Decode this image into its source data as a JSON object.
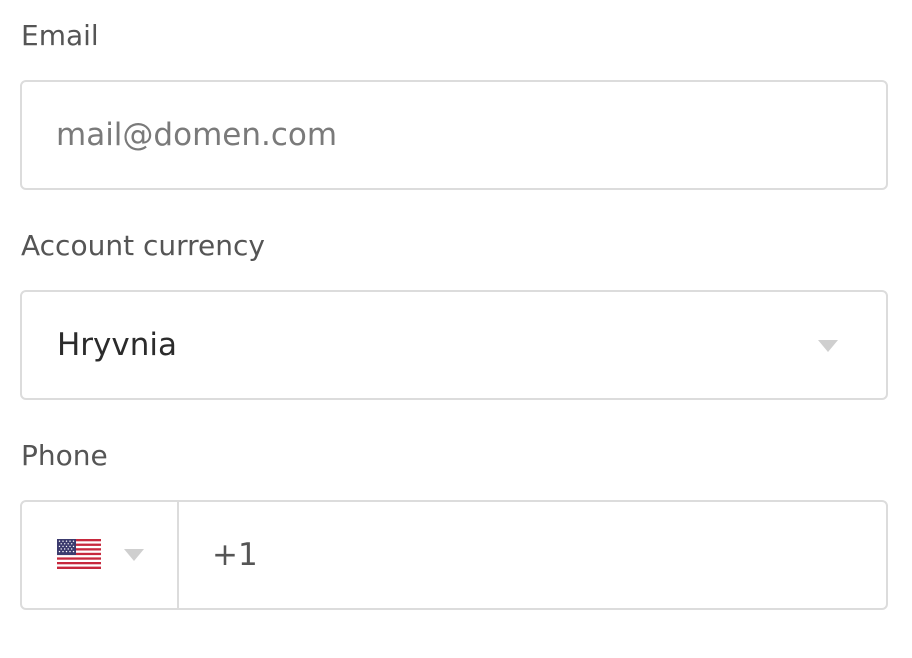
{
  "email": {
    "label": "Email",
    "value": "",
    "placeholder": "mail@domen.com"
  },
  "currency": {
    "label": "Account currency",
    "selected": "Hryvnia"
  },
  "phone": {
    "label": "Phone",
    "country_flag": "us-flag-icon",
    "value": "+1"
  },
  "colors": {
    "border": "#dcdcdc",
    "label": "#555555",
    "caret": "#cfcfcf"
  }
}
